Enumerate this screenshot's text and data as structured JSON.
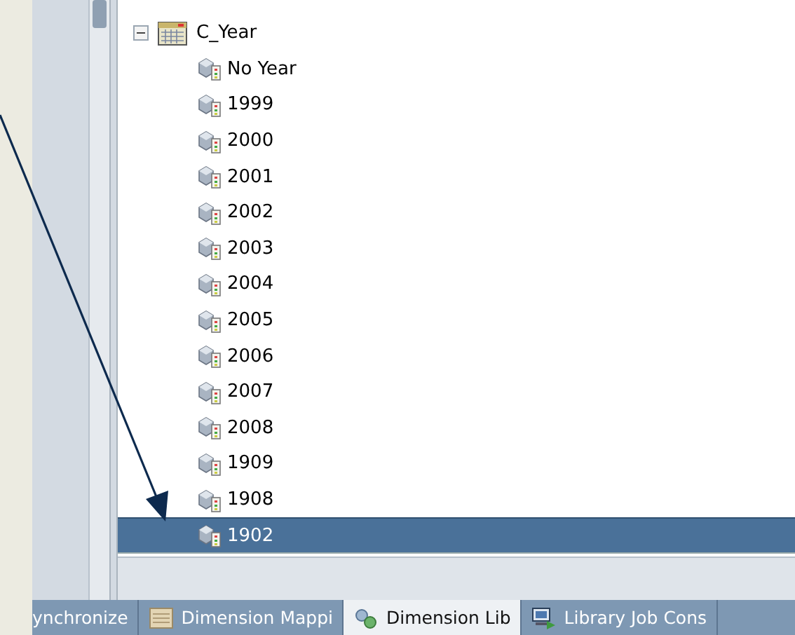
{
  "tree": {
    "label": "C_Year",
    "expanded": true,
    "children": [
      {
        "label": "No Year",
        "selected": false
      },
      {
        "label": "1999",
        "selected": false
      },
      {
        "label": "2000",
        "selected": false
      },
      {
        "label": "2001",
        "selected": false
      },
      {
        "label": "2002",
        "selected": false
      },
      {
        "label": "2003",
        "selected": false
      },
      {
        "label": "2004",
        "selected": false
      },
      {
        "label": "2005",
        "selected": false
      },
      {
        "label": "2006",
        "selected": false
      },
      {
        "label": "2007",
        "selected": false
      },
      {
        "label": "2008",
        "selected": false
      },
      {
        "label": "1909",
        "selected": false
      },
      {
        "label": "1908",
        "selected": false
      },
      {
        "label": "1902",
        "selected": true
      }
    ]
  },
  "tabs": [
    {
      "label": "ynchronize",
      "selected": false
    },
    {
      "label": "Dimension Mappi",
      "selected": false
    },
    {
      "label": "Dimension Lib",
      "selected": true
    },
    {
      "label": "Library Job Cons",
      "selected": false
    }
  ]
}
